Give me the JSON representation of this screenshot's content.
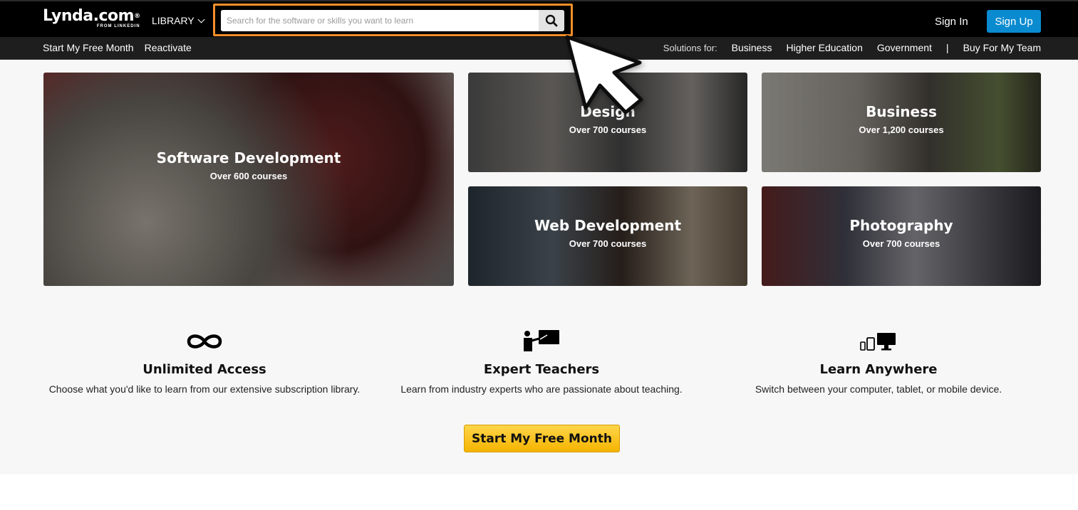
{
  "header": {
    "logo_main": "Lynda.com",
    "logo_reg": "®",
    "logo_sub": "FROM LINKEDIN",
    "library_label": "LIBRARY",
    "search_placeholder": "Search for the software or skills you want to learn",
    "sign_in": "Sign In",
    "sign_up": "Sign Up"
  },
  "subnav": {
    "start_free": "Start My Free Month",
    "reactivate": "Reactivate",
    "solutions_label": "Solutions for:",
    "business": "Business",
    "higher_ed": "Higher Education",
    "government": "Government",
    "separator": "|",
    "buy_team": "Buy For My Team"
  },
  "tiles": [
    {
      "title": "Software Development",
      "subtitle": "Over 600 courses"
    },
    {
      "title": "Design",
      "subtitle": "Over 700 courses"
    },
    {
      "title": "Business",
      "subtitle": "Over 1,200 courses"
    },
    {
      "title": "Web Development",
      "subtitle": "Over 700 courses"
    },
    {
      "title": "Photography",
      "subtitle": "Over 700 courses"
    }
  ],
  "features": [
    {
      "icon": "infinity-icon",
      "title": "Unlimited Access",
      "desc": "Choose what you'd like to learn from our extensive subscription library."
    },
    {
      "icon": "teacher-icon",
      "title": "Expert Teachers",
      "desc": "Learn from industry experts who are passionate about teaching."
    },
    {
      "icon": "devices-icon",
      "title": "Learn Anywhere",
      "desc": "Switch between your computer, tablet, or mobile device."
    }
  ],
  "cta_label": "Start My Free Month",
  "colors": {
    "accent_orange": "#f4902b",
    "signup_blue": "#0a8bd0",
    "cta_yellow": "#f4b400"
  }
}
